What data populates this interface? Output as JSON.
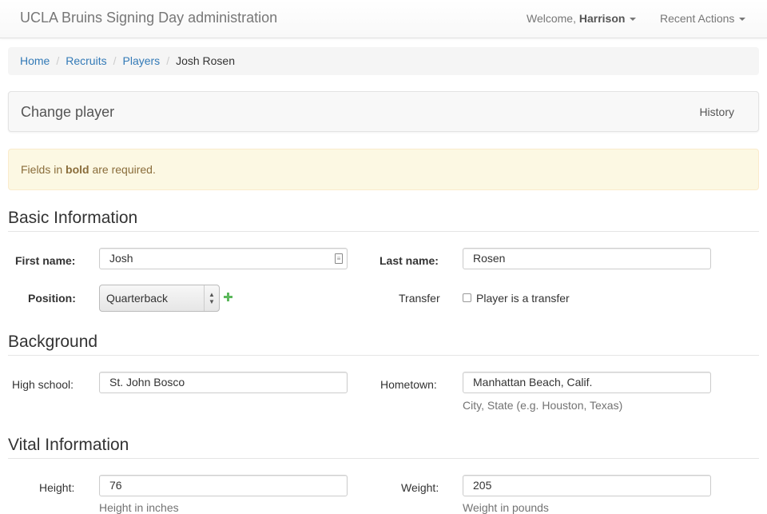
{
  "navbar": {
    "brand": "UCLA Bruins Signing Day administration",
    "welcome_prefix": "Welcome, ",
    "user_name": "Harrison",
    "recent_actions": "Recent Actions"
  },
  "breadcrumb": {
    "items": [
      "Home",
      "Recruits",
      "Players"
    ],
    "current": "Josh Rosen"
  },
  "header": {
    "title": "Change player",
    "history": "History"
  },
  "alert": {
    "prefix": "Fields in ",
    "bold": "bold",
    "suffix": " are required."
  },
  "sections": {
    "basic": {
      "title": "Basic Information",
      "first_name_label": "First name:",
      "first_name_value": "Josh",
      "last_name_label": "Last name:",
      "last_name_value": "Rosen",
      "position_label": "Position:",
      "position_value": "Quarterback",
      "transfer_label": "Transfer",
      "transfer_checkbox_label": "Player is a transfer",
      "transfer_checked": false
    },
    "background": {
      "title": "Background",
      "high_school_label": "High school:",
      "high_school_value": "St. John Bosco",
      "hometown_label": "Hometown:",
      "hometown_value": "Manhattan Beach, Calif.",
      "hometown_help": "City, State (e.g. Houston, Texas)"
    },
    "vital": {
      "title": "Vital Information",
      "height_label": "Height:",
      "height_value": "76",
      "height_help": "Height in inches",
      "weight_label": "Weight:",
      "weight_value": "205",
      "weight_help": "Weight in pounds"
    }
  },
  "colors": {
    "link": "#337ab7",
    "alert_bg": "#fcf8e3",
    "alert_text": "#8a6d3b",
    "add_icon": "#5cb85c"
  }
}
